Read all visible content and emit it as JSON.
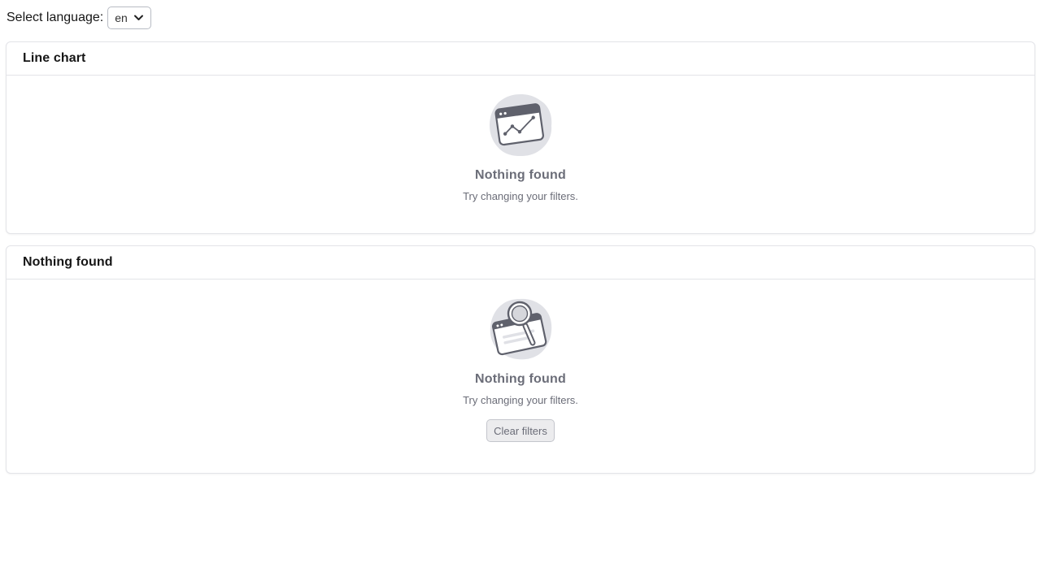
{
  "language": {
    "label": "Select language:",
    "selected": "en"
  },
  "panels": [
    {
      "title": "Line chart",
      "empty_title": "Nothing found",
      "empty_description": "Try changing your filters.",
      "illustration": "empty-line-chart-illustration"
    },
    {
      "title": "Nothing found",
      "empty_title": "Nothing found",
      "empty_description": "Try changing your filters.",
      "illustration": "empty-search-illustration",
      "action_label": "Clear filters"
    }
  ],
  "colors": {
    "muted_text": "#6b6d78",
    "border": "#e3e4e8",
    "illustration_blob": "#e0e1e6"
  }
}
